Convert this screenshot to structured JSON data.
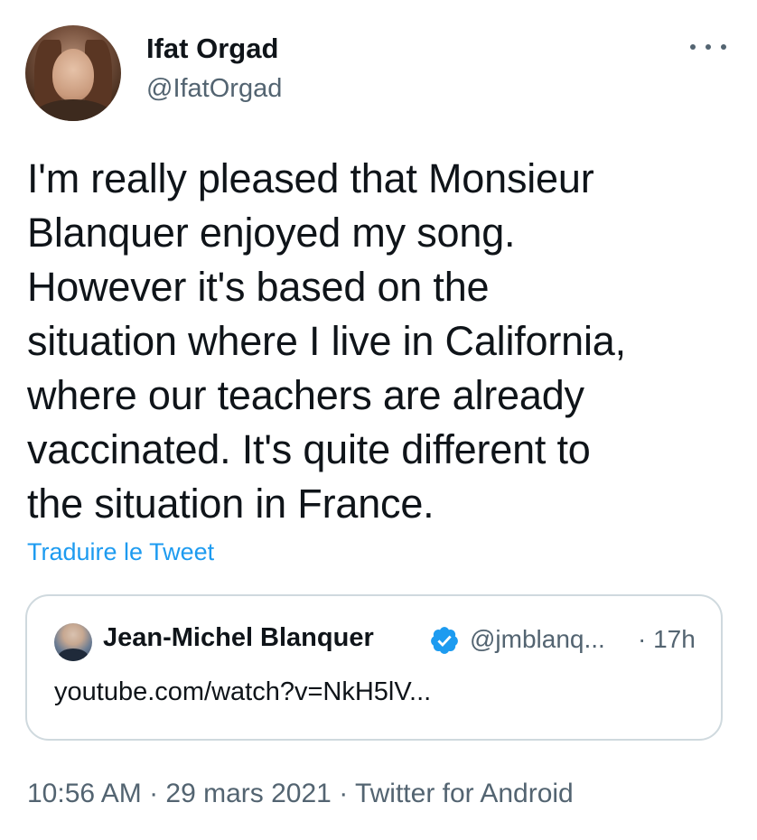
{
  "author": {
    "name": "Ifat Orgad",
    "handle": "@IfatOrgad"
  },
  "tweet": {
    "text": "I'm really pleased that Monsieur\nBlanquer enjoyed my song.\nHowever it's based on the\nsituation where I live in California,\nwhere our teachers are already\nvaccinated. It's quite different to\nthe situation in France.",
    "translate_label": "Traduire le Tweet"
  },
  "quote": {
    "name": "Jean-Michel Blanquer",
    "handle": "@jmblanq...",
    "time": "· 17h",
    "text": "youtube.com/watch?v=NkH5lV...",
    "verified_color": "#1d9bf0"
  },
  "meta": {
    "timestamp": "10:56 AM · 29 mars 2021 · Twitter for Android"
  },
  "icons": {
    "more": "more-options-icon",
    "verified": "verified-badge-icon"
  }
}
